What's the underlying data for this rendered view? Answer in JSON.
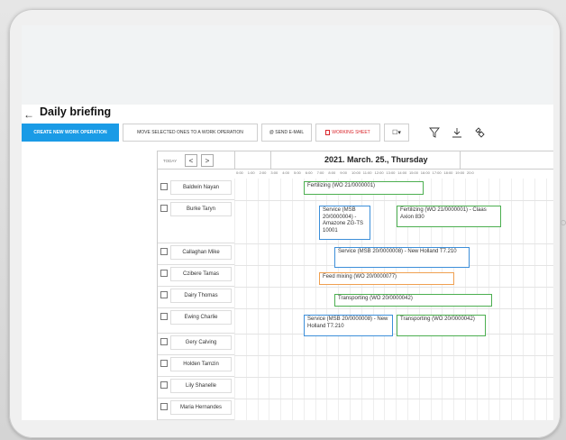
{
  "page": {
    "title": "Daily briefing",
    "back_icon": "arrow-left-icon"
  },
  "toolbar": {
    "create_label": "CREATE NEW WORK OPERATION",
    "move_label": "MOVE SELECTED ONES TO A WORK OPERATION",
    "email_label": "@ SEND E-MAIL",
    "sheet_label": "WORKING SHEET",
    "sheet_icon": "pdf-icon",
    "select_label": "☐▾",
    "filter_icon": "filter-icon",
    "download_icon": "download-icon",
    "link_icon": "link-icon",
    "accent_color": "#1a9be6"
  },
  "calendar": {
    "today_label": "TODAY",
    "prev_label": "<",
    "next_label": ">",
    "date_title": "2021. March. 25., Thursday",
    "hours": [
      "0:00",
      "1:00",
      "2:00",
      "3:00",
      "4:00",
      "5:00",
      "6:00",
      "7:00",
      "8:00",
      "9:00",
      "10:00",
      "11:00",
      "12:00",
      "13:00",
      "14:00",
      "15:00",
      "16:00",
      "17:00",
      "18:00",
      "19:00",
      "20:0"
    ],
    "rows": [
      {
        "name": "Baldwin Nayan"
      },
      {
        "name": "Burke Taryn"
      },
      {
        "name": "Callaghan Mike"
      },
      {
        "name": "Czibere Tamas"
      },
      {
        "name": "Dairy Thomas"
      },
      {
        "name": "Ewing Charlie"
      },
      {
        "name": "Gery Calving"
      },
      {
        "name": "Holden Tamzin"
      },
      {
        "name": "Lily Shanelle"
      },
      {
        "name": "Maria Hernandes"
      }
    ],
    "events": [
      {
        "text": "Fertilizing (WO 21/0000001)",
        "color": "green"
      },
      {
        "text": "Service (MSB 20/0000004) - Amazone ZG-TS 10001",
        "color": "blue"
      },
      {
        "text": "Fertilizing (WO 21/0000001) - Claas Axion 830",
        "color": "green"
      },
      {
        "text": "Service (MSB 20/0000008) - New Holland T7.210",
        "color": "blue"
      },
      {
        "text": "Feed mixing (WO 20/0000077)",
        "color": "orange"
      },
      {
        "text": "Transporting (WO 20/0000042)",
        "color": "green"
      },
      {
        "text": "Service (MSB 20/0000008) - New Holland T7.210",
        "color": "blue"
      },
      {
        "text": "Transporting (WO 20/0000042)",
        "color": "green"
      }
    ]
  }
}
